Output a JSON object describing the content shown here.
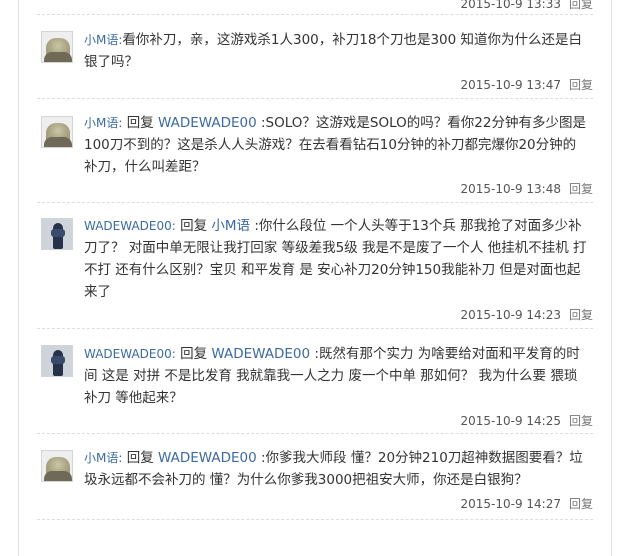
{
  "reply_word": "回复",
  "reply_link": "回复",
  "comments": [
    {
      "meta_time": "2015-10-9 13:33"
    },
    {
      "user": "小M语:",
      "text": "看你补刀，亲，这游戏杀1人300，补刀18个刀也是300 知道你为什么还是白银了吗？",
      "time": "2015-10-9 13:47"
    },
    {
      "user": "小M语:",
      "target": "WADEWADE00",
      "text": " :SOLO？这游戏是SOLO的吗？看你22分钟有多少图是100刀不到的？这是杀人人头游戏？在去看看钻石10分钟的补刀都完爆你20分钟的补刀，什么叫差距？",
      "time": "2015-10-9 13:48"
    },
    {
      "user": "WADEWADE00:",
      "target": "小M语",
      "text": " :你什么段位 一个人头等于13个兵 那我抢了对面多少补刀了？ 对面中单无限让我打回家 等级差我5级 我是不是废了一个人 他挂机不挂机 打不打 还有什么区别？宝贝 和平发育 是 安心补刀20分钟150我能补刀 但是对面也起来了",
      "time": "2015-10-9 14:23"
    },
    {
      "user": "WADEWADE00:",
      "target": "WADEWADE00",
      "text": " :既然有那个实力 为啥要给对面和平发育的时间 这是 对拼 不是比发育 我就靠我一人之力 废一个中单 那如何？ 我为什么要 猥琐补刀 等他起来？",
      "time": "2015-10-9 14:25"
    },
    {
      "user": "小M语:",
      "target": "WADEWADE00",
      "text": " :你爹我大师段 懂？20分钟210刀超神数据图要看？垃圾永远都不会补刀的 懂？为什么你爹我3000把祖安大师，你还是白银狗？",
      "time": "2015-10-9 14:27"
    }
  ]
}
